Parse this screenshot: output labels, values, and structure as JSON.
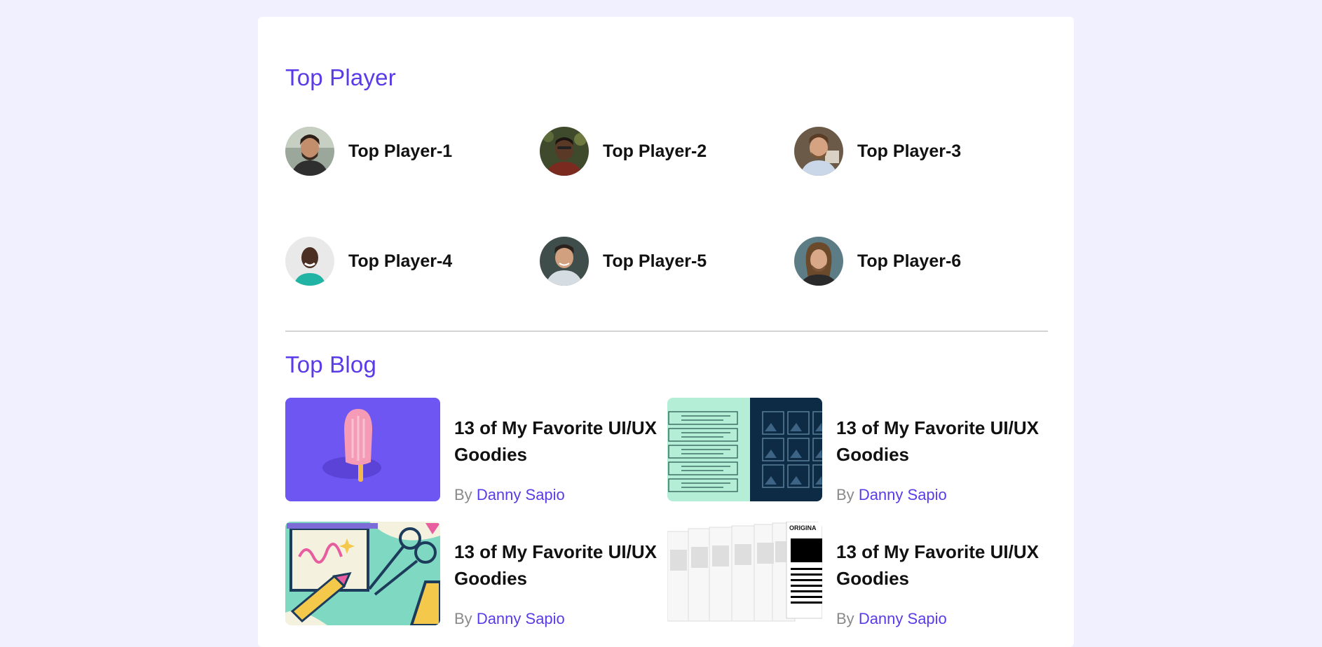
{
  "top_player": {
    "title": "Top Player",
    "players": [
      {
        "name": "Top Player-1"
      },
      {
        "name": "Top Player-2"
      },
      {
        "name": "Top Player-3"
      },
      {
        "name": "Top Player-4"
      },
      {
        "name": "Top Player-5"
      },
      {
        "name": "Top Player-6"
      }
    ]
  },
  "top_blog": {
    "title": "Top Blog",
    "posts": [
      {
        "title": "13 of My Favorite UI/UX Goodies",
        "by": "By",
        "author": "Danny Sapio",
        "thumb_icon": "popsicle-illustration"
      },
      {
        "title": "13 of My Favorite UI/UX Goodies",
        "by": "By",
        "author": "Danny Sapio",
        "thumb_icon": "wireframe-grid-illustration"
      },
      {
        "title": "13 of My Favorite UI/UX Goodies",
        "by": "By",
        "author": "Danny Sapio",
        "thumb_icon": "crayon-scissors-illustration"
      },
      {
        "title": "13 of My Favorite UI/UX Goodies",
        "by": "By",
        "author": "Danny Sapio",
        "thumb_icon": "original-pages-illustration"
      }
    ],
    "thumb4_label": "ORIGINA"
  },
  "colors": {
    "page_bg": "#f1f0fe",
    "accent": "#5b3be8",
    "text": "#111111",
    "muted": "#8a8a8a"
  }
}
